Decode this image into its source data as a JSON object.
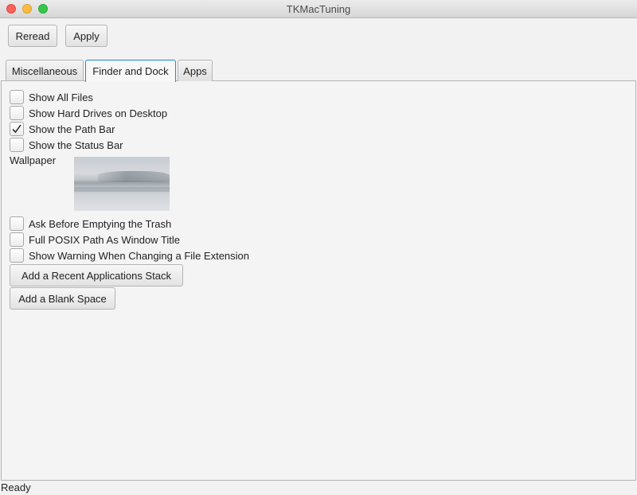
{
  "window": {
    "title": "TKMacTuning"
  },
  "toolbar": {
    "reread_label": "Reread",
    "apply_label": "Apply"
  },
  "tabs": [
    {
      "label": "Miscellaneous",
      "selected": false
    },
    {
      "label": "Finder and Dock",
      "selected": true
    },
    {
      "label": "Apps",
      "selected": false
    }
  ],
  "finder": {
    "options": [
      {
        "label": "Show All Files",
        "checked": false
      },
      {
        "label": "Show Hard Drives on Desktop",
        "checked": false
      },
      {
        "label": "Show the Path Bar",
        "checked": true
      },
      {
        "label": "Show the Status Bar",
        "checked": false
      }
    ],
    "wallpaper_label": "Wallpaper",
    "options2": [
      {
        "label": "Ask Before Emptying the Trash",
        "checked": false
      },
      {
        "label": "Full POSIX Path As Window Title",
        "checked": false
      },
      {
        "label": "Show Warning When Changing a File Extension",
        "checked": false
      }
    ],
    "add_recent_stack_label": "Add a Recent Applications Stack",
    "add_blank_space_label": "Add a Blank Space"
  },
  "status": {
    "text": "Ready"
  },
  "colors": {
    "accent": "#1c8ad8",
    "close": "#fc605b",
    "minimize": "#fdbc40",
    "maximize": "#34c84a"
  }
}
